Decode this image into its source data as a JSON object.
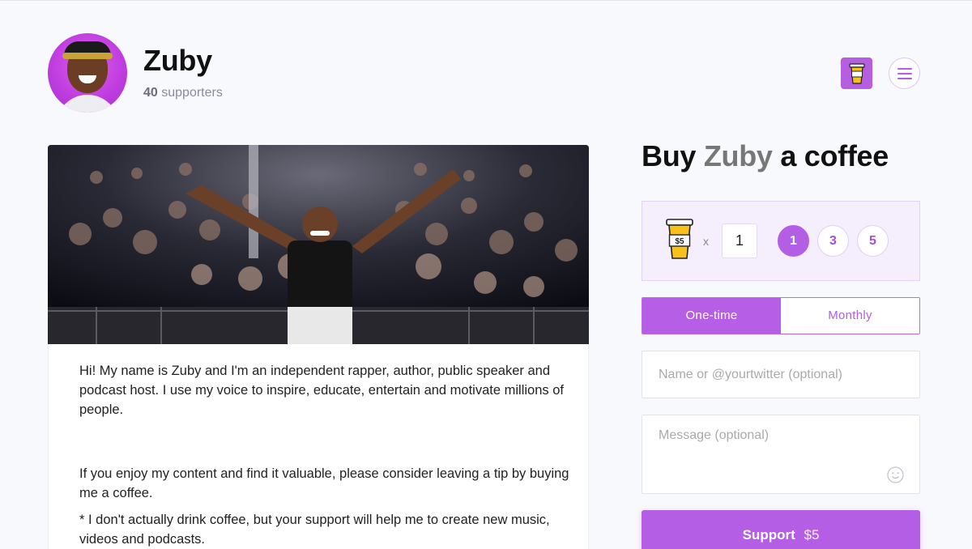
{
  "creator": {
    "name": "Zuby",
    "supporters_count": "40",
    "supporters_label": "supporters"
  },
  "header": {
    "coffee_icon": "coffee-cup-icon",
    "menu_icon": "hamburger-menu-icon"
  },
  "about": {
    "paragraphs": [
      "Hi! My name is Zuby and I'm an independent rapper, author, public speaker and podcast host. I use my voice to inspire, educate, entertain and motivate millions of people.",
      "If you enjoy my content and find it valuable, please consider leaving a tip by buying me a coffee.",
      "* I don't actually drink coffee, but your support will help me to create new music, videos and podcasts."
    ]
  },
  "purchase": {
    "title_prefix": "Buy",
    "title_name": "Zuby",
    "title_suffix": "a coffee",
    "cup_price_label": "$5",
    "times_symbol": "x",
    "quantity_value": "1",
    "quantity_options": [
      "1",
      "3",
      "5"
    ],
    "selected_quantity": "1",
    "frequency": {
      "one_time": "One-time",
      "monthly": "Monthly",
      "selected": "One-time"
    },
    "name_placeholder": "Name or @yourtwitter (optional)",
    "message_placeholder": "Message (optional)",
    "support_label": "Support",
    "support_amount": "$5"
  },
  "colors": {
    "accent": "#b45ee6",
    "accent_light": "#f5eefd",
    "cup_yellow": "#f6c21a",
    "background": "#f8f9fc"
  }
}
